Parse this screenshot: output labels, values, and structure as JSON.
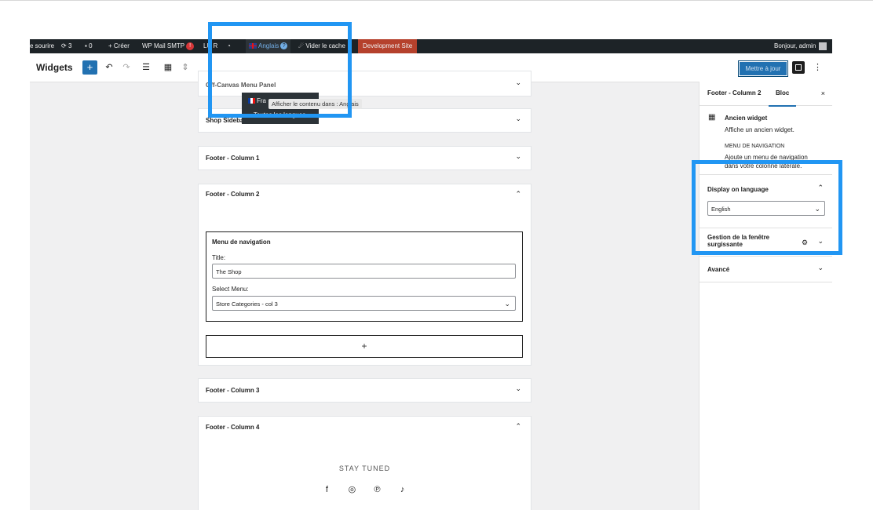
{
  "adminbar": {
    "site": "e sourire",
    "updates": "3",
    "comments": "0",
    "create": "Créer",
    "mailsmtp": "WP Mail SMTP",
    "mailsmtp_badge": "!",
    "lu": "LU R",
    "language": "Anglais",
    "language_badge": "?",
    "cache": "Vider le cache",
    "devsite": "Development Site",
    "greeting": "Bonjour, admin"
  },
  "dropdown": {
    "item1": "Fra",
    "item2": "Toutes les langues",
    "tooltip": "Afficher le contenu dans : Anglais"
  },
  "header": {
    "title": "Widgets",
    "update_label": "Mettre à jour"
  },
  "cards": {
    "canvas": "Off-Canvas Menu Panel",
    "shop": "Shop Sidebar",
    "col1": "Footer - Column 1",
    "col2": "Footer - Column 2",
    "col3": "Footer - Column 3",
    "col4": "Footer - Column 4"
  },
  "nav_widget": {
    "title": "Menu de navigation",
    "title_label": "Title:",
    "title_value": "The Shop",
    "menu_label": "Select Menu:",
    "menu_value": "Store Categories - col 3",
    "add_label": "+"
  },
  "footer4": {
    "stay_tuned": "STAY TUNED",
    "socials": [
      "facebook-icon",
      "instagram-icon",
      "pinterest-icon",
      "tiktok-icon"
    ]
  },
  "sidebar": {
    "tab_area": "Footer - Column 2",
    "tab_block": "Bloc",
    "close": "×",
    "block_name": "Ancien widget",
    "block_desc": "Affiche un ancien widget.",
    "nav_heading": "MENU DE NAVIGATION",
    "nav_desc_1": "Ajoute un menu de navigation",
    "nav_desc_2": "dans votre colonne latérale.",
    "display_lang": "Display on language",
    "lang_value": "English",
    "popup_1": "Gestion de la fenêtre",
    "popup_2": "surgissante",
    "advanced": "Avancé"
  },
  "colors": {
    "accent": "#2271b1",
    "highlight": "#2196f3",
    "adminbar": "#1d2327",
    "devsite": "#b5412c"
  }
}
